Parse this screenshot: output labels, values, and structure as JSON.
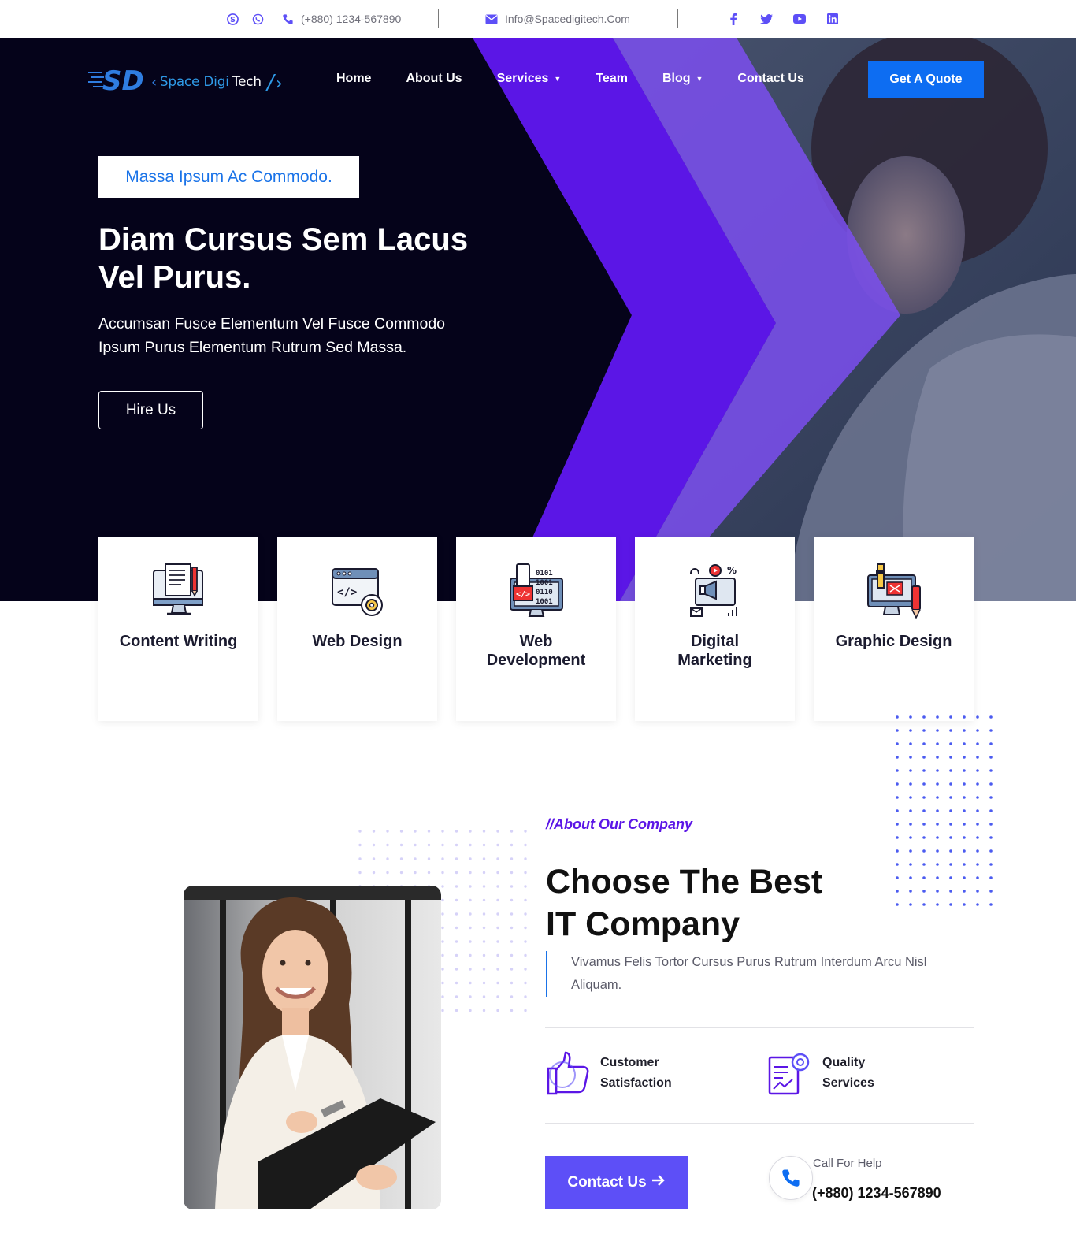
{
  "topbar": {
    "phone": "(+880) 1234-567890",
    "email": "Info@Spacedigitech.Com",
    "icons": [
      "skype-icon",
      "whatsapp-icon",
      "phone-icon",
      "mail-icon",
      "facebook-icon",
      "twitter-icon",
      "youtube-icon",
      "linkedin-icon"
    ]
  },
  "brand": {
    "logo_mark": "SD",
    "name_part1": "Space Digi",
    "name_part2": "Tech"
  },
  "nav": {
    "items": [
      {
        "label": "Home",
        "has_dropdown": false
      },
      {
        "label": "About Us",
        "has_dropdown": false
      },
      {
        "label": "Services",
        "has_dropdown": true
      },
      {
        "label": "Team",
        "has_dropdown": false
      },
      {
        "label": "Blog",
        "has_dropdown": true
      },
      {
        "label": "Contact Us",
        "has_dropdown": false
      }
    ],
    "quote_button": "Get A Quote"
  },
  "hero": {
    "tagline": "Massa Ipsum Ac Commodo.",
    "title": "Diam Cursus Sem Lacus Vel Purus.",
    "subtitle": "Accumsan Fusce Elementum Vel Fusce Commodo Ipsum Purus Elementum Rutrum Sed Massa.",
    "button": "Hire Us"
  },
  "services": [
    {
      "label": "Content Writing",
      "icon": "content-writing-icon"
    },
    {
      "label": "Web Design",
      "icon": "web-design-icon"
    },
    {
      "label": "Web Development",
      "icon": "web-development-icon"
    },
    {
      "label": "Digital Marketing",
      "icon": "digital-marketing-icon"
    },
    {
      "label": "Graphic Design",
      "icon": "graphic-design-icon"
    }
  ],
  "about": {
    "kicker": "//About Our Company",
    "title_line1": "Choose The Best",
    "title_line2": "IT Company",
    "quote": "Vivamus Felis Tortor Cursus Purus Rutrum Interdum Arcu Nisl Aliquam.",
    "features": [
      {
        "line1": "Customer",
        "line2": "Satisfaction",
        "icon": "thumbs-up-icon"
      },
      {
        "line1": "Quality",
        "line2": "Services",
        "icon": "quality-report-icon"
      }
    ],
    "contact_button": "Contact Us",
    "help_label": "Call For Help",
    "help_phone": "(+880) 1234-567890"
  },
  "colors": {
    "hero_bg": "#05031a",
    "accent_purple": "#5d4ff7",
    "accent_blue": "#0d6df2",
    "chevron_dark": "#5b16e6",
    "chevron_light": "#7b4ff0"
  }
}
